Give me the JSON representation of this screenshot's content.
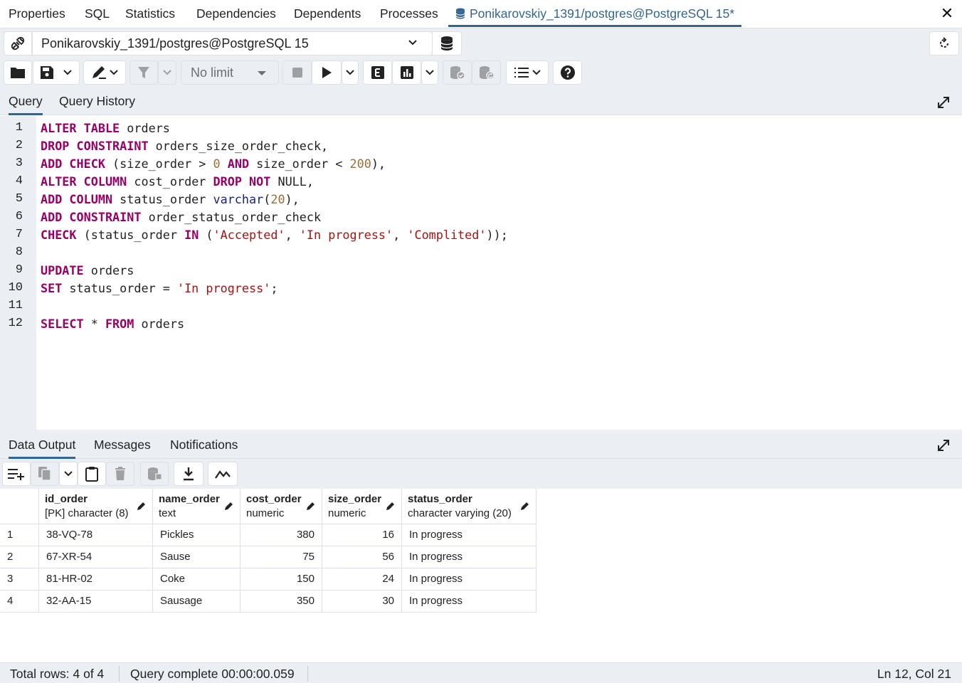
{
  "top_tabs": [
    {
      "label": "Properties"
    },
    {
      "label": "SQL"
    },
    {
      "label": "Statistics"
    },
    {
      "label": "Dependencies"
    },
    {
      "label": "Dependents"
    },
    {
      "label": "Processes"
    },
    {
      "label": "Ponikarovskiy_1391/postgres@PostgreSQL 15*",
      "active": true
    }
  ],
  "connection": {
    "selected": "Ponikarovskiy_1391/postgres@PostgreSQL 15"
  },
  "toolbar": {
    "limit_selected": "No limit"
  },
  "editor_tabs": [
    {
      "label": "Query",
      "active": true
    },
    {
      "label": "Query History"
    }
  ],
  "editor": {
    "line_numbers": [
      "1",
      "2",
      "3",
      "4",
      "5",
      "6",
      "7",
      "8",
      "9",
      "10",
      "11",
      "12"
    ],
    "lines": [
      "ALTER TABLE orders",
      "DROP CONSTRAINT orders_size_order_check,",
      "ADD CHECK (size_order > 0 AND size_order < 200),",
      "ALTER COLUMN cost_order DROP NOT NULL,",
      "ADD COLUMN status_order varchar(20),",
      "ADD CONSTRAINT order_status_order_check",
      "CHECK (status_order IN ('Accepted', 'In progress', 'Complited'));",
      "",
      "UPDATE orders",
      "SET status_order = 'In progress';",
      "",
      "SELECT * FROM orders"
    ]
  },
  "result_tabs": [
    {
      "label": "Data Output",
      "active": true
    },
    {
      "label": "Messages"
    },
    {
      "label": "Notifications"
    }
  ],
  "grid": {
    "columns": [
      {
        "name": "id_order",
        "type": "[PK] character (8)"
      },
      {
        "name": "name_order",
        "type": "text"
      },
      {
        "name": "cost_order",
        "type": "numeric"
      },
      {
        "name": "size_order",
        "type": "numeric"
      },
      {
        "name": "status_order",
        "type": "character varying (20)"
      }
    ],
    "rows": [
      {
        "n": "1",
        "cells": [
          "38-VQ-78",
          "Pickles",
          "380",
          "16",
          "In progress"
        ]
      },
      {
        "n": "2",
        "cells": [
          "67-XR-54",
          "Sause",
          "75",
          "56",
          "In progress"
        ]
      },
      {
        "n": "3",
        "cells": [
          "81-HR-02",
          "Coke",
          "150",
          "24",
          "In progress"
        ]
      },
      {
        "n": "4",
        "cells": [
          "32-AA-15",
          "Sausage",
          "350",
          "30",
          "In progress"
        ]
      }
    ]
  },
  "status": {
    "total_rows": "Total rows: 4 of 4",
    "query_status": "Query complete 00:00:00.059",
    "cursor": "Ln 12, Col 21"
  },
  "colors": {
    "accent": "#326690",
    "keyword": "#990066",
    "string": "#aa1111",
    "number": "#9a6e3a",
    "panel_bg": "#ebeef3"
  }
}
